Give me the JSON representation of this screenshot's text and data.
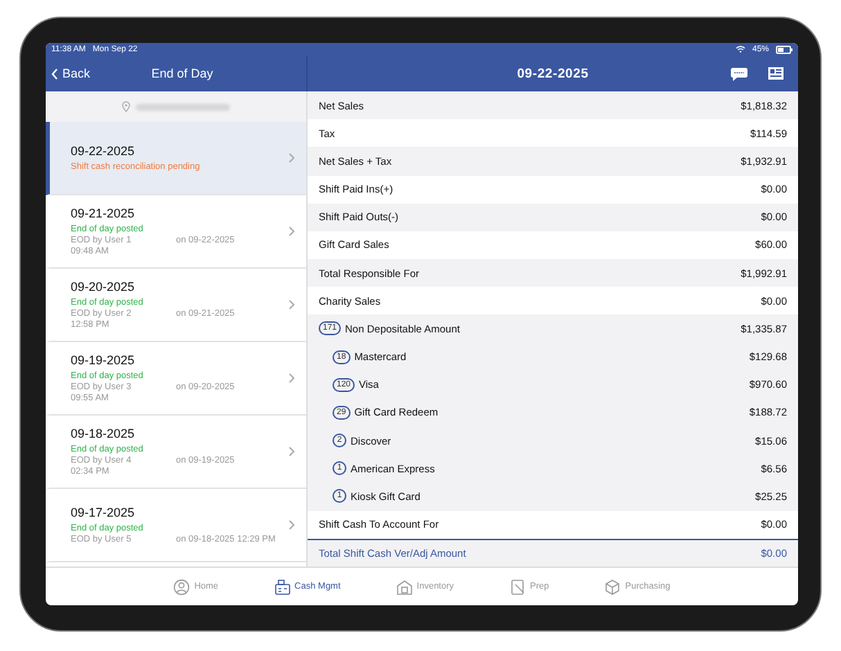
{
  "status_bar": {
    "time": "11:38 AM",
    "date": "Mon Sep 22",
    "battery": "45%"
  },
  "left_header": {
    "back": "Back",
    "title": "End of Day"
  },
  "right_header": {
    "title": "09-22-2025"
  },
  "eod_list": [
    {
      "date": "09-22-2025",
      "status": "Shift cash reconciliation pending",
      "kind": "pending",
      "selected": true
    },
    {
      "date": "09-21-2025",
      "status": "End of day posted",
      "kind": "posted",
      "user": "EOD by User 1",
      "posted_on": "on 09-22-2025",
      "time": "09:48 AM",
      "selected": false
    },
    {
      "date": "09-20-2025",
      "status": "End of day posted",
      "kind": "posted",
      "user": "EOD by User 2",
      "posted_on": "on 09-21-2025",
      "time": "12:58 PM",
      "selected": false
    },
    {
      "date": "09-19-2025",
      "status": "End of day posted",
      "kind": "posted",
      "user": "EOD by User 3",
      "posted_on": "on 09-20-2025",
      "time": "09:55 AM",
      "selected": false
    },
    {
      "date": "09-18-2025",
      "status": "End of day posted",
      "kind": "posted",
      "user": "EOD by User 4",
      "posted_on": "on 09-19-2025",
      "time": "02:34 PM",
      "selected": false
    },
    {
      "date": "09-17-2025",
      "status": "End of day posted",
      "kind": "posted",
      "user": "EOD by User 5",
      "posted_on": "on 09-18-2025 12:29 PM",
      "selected": false
    }
  ],
  "summary": [
    {
      "kind": "plain",
      "label": "Net Sales",
      "amount": "$1,818.32"
    },
    {
      "kind": "plain",
      "label": "Tax",
      "amount": "$114.59"
    },
    {
      "kind": "plain",
      "label": "Net Sales + Tax",
      "amount": "$1,932.91"
    },
    {
      "kind": "plain",
      "label": "Shift Paid Ins(+)",
      "amount": "$0.00"
    },
    {
      "kind": "plain",
      "label": "Shift Paid Outs(-)",
      "amount": "$0.00"
    },
    {
      "kind": "plain",
      "label": "Gift Card Sales",
      "amount": "$60.00"
    },
    {
      "kind": "plain",
      "label": "Total Responsible For",
      "amount": "$1,992.91"
    },
    {
      "kind": "plain",
      "label": "Charity Sales",
      "amount": "$0.00"
    },
    {
      "kind": "group",
      "count": "171",
      "label": "Non Depositable Amount",
      "amount": "$1,335.87"
    },
    {
      "kind": "sub",
      "count": "18",
      "label": "Mastercard",
      "amount": "$129.68"
    },
    {
      "kind": "sub",
      "count": "120",
      "label": "Visa",
      "amount": "$970.60"
    },
    {
      "kind": "sub",
      "count": "29",
      "label": "Gift Card Redeem",
      "amount": "$188.72"
    },
    {
      "kind": "sub",
      "count": "2",
      "label": "Discover",
      "amount": "$15.06"
    },
    {
      "kind": "sub",
      "count": "1",
      "label": "American Express",
      "amount": "$6.56"
    },
    {
      "kind": "sub",
      "count": "1",
      "label": "Kiosk Gift Card",
      "amount": "$25.25"
    },
    {
      "kind": "plain",
      "label": "Shift Cash To Account For",
      "amount": "$0.00"
    },
    {
      "kind": "total",
      "label": "Total Shift Cash Ver/Adj Amount",
      "amount": "$0.00"
    }
  ],
  "tabs": [
    {
      "label": "Home",
      "selected": false
    },
    {
      "label": "Cash Mgmt",
      "selected": true
    },
    {
      "label": "Inventory",
      "selected": false
    },
    {
      "label": "Prep",
      "selected": false
    },
    {
      "label": "Purchasing",
      "selected": false
    }
  ]
}
